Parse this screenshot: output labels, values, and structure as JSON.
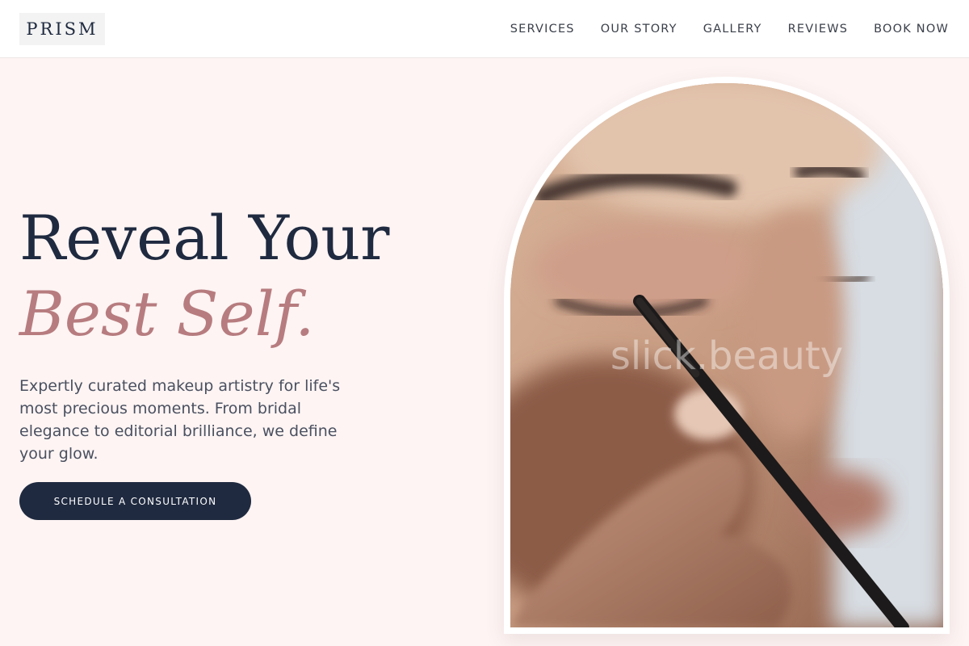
{
  "brand": {
    "logo": "PRISM"
  },
  "nav": {
    "items": [
      "SERVICES",
      "OUR STORY",
      "GALLERY",
      "REVIEWS",
      "BOOK NOW"
    ]
  },
  "hero": {
    "title_line1": "Reveal Your",
    "title_line2": "Best Self.",
    "description": "Expertly curated makeup artistry for life's most precious moments. From bridal elegance to editorial brilliance, we define your glow.",
    "cta_label": "SCHEDULE A CONSULTATION"
  },
  "image": {
    "watermark": "slick.beauty",
    "subject": "makeup brush applied to closed eyelid"
  },
  "colors": {
    "background": "#fdf4f3",
    "navy": "#1f2a40",
    "accent_rose": "#b77c7f",
    "header_bg": "#ffffff"
  }
}
